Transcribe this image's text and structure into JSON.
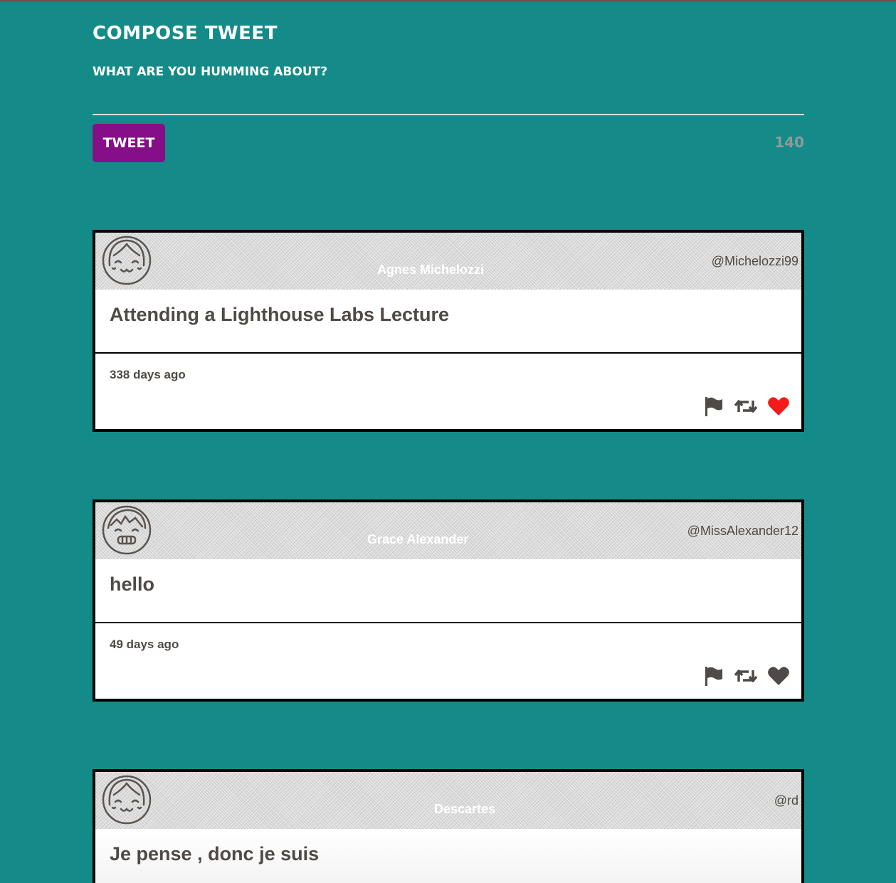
{
  "compose": {
    "title": "Compose Tweet",
    "prompt": "What are you humming about?",
    "button_label": "Tweet",
    "counter": "140"
  },
  "tweets": [
    {
      "name": "Agnes Michelozzi",
      "handle": "@Michelozzi99",
      "content": "Attending a Lighthouse Labs Lecture",
      "age": "338 days ago",
      "avatar_icon": "smiling-face-icon",
      "liked": true
    },
    {
      "name": "Grace Alexander",
      "handle": "@MissAlexander12",
      "content": "hello",
      "age": "49 days ago",
      "avatar_icon": "grinning-face-icon",
      "liked": false
    },
    {
      "name": "Descartes",
      "handle": "@rd",
      "content": "Je pense , donc je suis",
      "age": "",
      "avatar_icon": "smiling-face-icon",
      "liked": false
    }
  ],
  "icons": {
    "flag": "flag-icon",
    "retweet": "retweet-icon",
    "heart": "heart-icon"
  },
  "colors": {
    "background": "#148b89",
    "button": "#850f87",
    "liked_heart": "#f31a1a",
    "text": "#4f4a45"
  }
}
